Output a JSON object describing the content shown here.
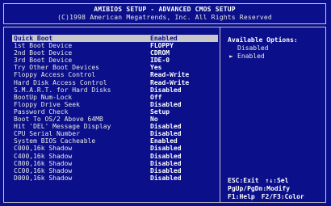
{
  "header": {
    "title": "AMIBIOS SETUP - ADVANCED CMOS SETUP",
    "copyright": "(C)1998 American Megatrends, Inc. All Rights Reserved"
  },
  "menu": {
    "items": [
      {
        "label": "Quick Boot",
        "value": "Enabled",
        "selected": true
      },
      {
        "label": "1st Boot Device",
        "value": "FLOPPY"
      },
      {
        "label": "2nd Boot Device",
        "value": "CDROM"
      },
      {
        "label": "3rd Boot Device",
        "value": "IDE-0"
      },
      {
        "label": "Try Other Boot Devices",
        "value": "Yes"
      },
      {
        "label": "Floppy Access Control",
        "value": "Read-Write"
      },
      {
        "label": "Hard Disk Access Control",
        "value": "Read-Write"
      },
      {
        "label": "S.M.A.R.T. for Hard Disks",
        "value": "Disabled"
      },
      {
        "label": "BootUp Num-Lock",
        "value": "Off"
      },
      {
        "label": "Floppy Drive Seek",
        "value": "Disabled"
      },
      {
        "label": "Password Check",
        "value": "Setup"
      },
      {
        "label": "Boot To OS/2 Above 64MB",
        "value": "No"
      },
      {
        "label": "Hit 'DEL' Message Display",
        "value": "Disabled"
      },
      {
        "label": "CPU Serial Number",
        "value": "Disabled"
      },
      {
        "label": "System BIOS Cacheable",
        "value": "Enabled"
      },
      {
        "label": "C000,16k Shadow",
        "value": "Disabled"
      },
      {
        "label": "C400,16k Shadow",
        "value": "Disabled"
      },
      {
        "label": "C800,16k Shadow",
        "value": "Disabled"
      },
      {
        "label": "CC00,16k Shadow",
        "value": "Disabled"
      },
      {
        "label": "D000,16k Shadow",
        "value": "Disabled"
      }
    ]
  },
  "help": {
    "title": "Available Options:",
    "options": [
      "Disabled",
      "Enabled"
    ],
    "current_marker": "►"
  },
  "keys": {
    "esc": "ESC:Exit",
    "sel": "↑↓:Sel",
    "pgupdn": "PgUp/PgDn:Modify",
    "f1": "F1:Help",
    "f2f3": "F2/F3:Color"
  },
  "colors": {
    "background": "#0b0f8a",
    "highlight": "#c9c9c9",
    "text": "#e8e8e8"
  }
}
